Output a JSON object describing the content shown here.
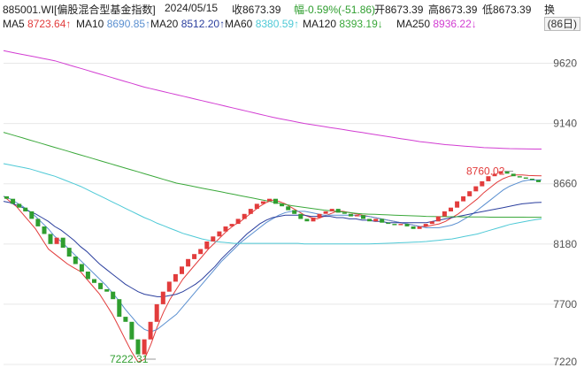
{
  "header": {
    "code_name": "885001.WI[偏股混合型基金指数]",
    "date": "2024/05/15",
    "close": "收8673.39",
    "change": "幅-0.59%(-51.86)",
    "open": "开8673.39",
    "high": "高8673.39",
    "low": "低8673.39",
    "turnover": "换"
  },
  "period_button": "(86日)",
  "ma_labels": [
    {
      "name": "MA5",
      "value": "8723.64↑",
      "color": "#e23c3c"
    },
    {
      "name": "MA10",
      "value": "8690.85↑",
      "color": "#5a8fd0"
    },
    {
      "name": "MA20",
      "value": "8512.20↑",
      "color": "#2b3f9e"
    },
    {
      "name": "MA60",
      "value": "8380.59↑",
      "color": "#4ec9d6"
    },
    {
      "name": "MA120",
      "value": "8393.19↓",
      "color": "#3aa83a"
    },
    {
      "name": "MA250",
      "value": "8936.22↓",
      "color": "#d23dd2"
    }
  ],
  "colors": {
    "up": "#e23c3c",
    "down": "#2f9e2f",
    "grid": "#e8e8e8"
  },
  "chart_data": {
    "type": "line",
    "ylim": [
      7220,
      9800
    ],
    "yticks": [
      7220,
      7700,
      8180,
      8660,
      9140,
      9620
    ],
    "annotations": [
      {
        "text": "8760.02",
        "value": 8760.02,
        "position": "top-right"
      },
      {
        "text": "7222.31",
        "value": 7222.31,
        "position": "bottom-left"
      }
    ],
    "candles": [
      [
        8560,
        8540
      ],
      [
        8540,
        8500
      ],
      [
        8500,
        8470
      ],
      [
        8470,
        8440
      ],
      [
        8440,
        8380
      ],
      [
        8380,
        8320
      ],
      [
        8320,
        8260
      ],
      [
        8260,
        8180
      ],
      [
        8180,
        8230
      ],
      [
        8230,
        8150
      ],
      [
        8150,
        8080
      ],
      [
        8080,
        8020
      ],
      [
        8020,
        7960
      ],
      [
        7960,
        7900
      ],
      [
        7900,
        7870
      ],
      [
        7870,
        7820
      ],
      [
        7820,
        7800
      ],
      [
        7800,
        7740
      ],
      [
        7740,
        7600
      ],
      [
        7600,
        7560
      ],
      [
        7560,
        7420
      ],
      [
        7420,
        7300
      ],
      [
        7300,
        7420
      ],
      [
        7420,
        7560
      ],
      [
        7560,
        7700
      ],
      [
        7700,
        7800
      ],
      [
        7800,
        7880
      ],
      [
        7880,
        7940
      ],
      [
        7940,
        8000
      ],
      [
        8000,
        8060
      ],
      [
        8060,
        8100
      ],
      [
        8100,
        8140
      ],
      [
        8140,
        8200
      ],
      [
        8200,
        8240
      ],
      [
        8240,
        8280
      ],
      [
        8280,
        8320
      ],
      [
        8320,
        8340
      ],
      [
        8340,
        8380
      ],
      [
        8380,
        8420
      ],
      [
        8420,
        8460
      ],
      [
        8460,
        8500
      ],
      [
        8500,
        8520
      ],
      [
        8520,
        8540
      ],
      [
        8540,
        8500
      ],
      [
        8500,
        8480
      ],
      [
        8480,
        8450
      ],
      [
        8450,
        8420
      ],
      [
        8420,
        8380
      ],
      [
        8380,
        8360
      ],
      [
        8360,
        8390
      ],
      [
        8390,
        8420
      ],
      [
        8420,
        8440
      ],
      [
        8440,
        8460
      ],
      [
        8460,
        8430
      ],
      [
        8430,
        8420
      ],
      [
        8420,
        8400
      ],
      [
        8400,
        8410
      ],
      [
        8410,
        8380
      ],
      [
        8380,
        8360
      ],
      [
        8360,
        8380
      ],
      [
        8380,
        8350
      ],
      [
        8350,
        8340
      ],
      [
        8340,
        8330
      ],
      [
        8330,
        8340
      ],
      [
        8340,
        8320
      ],
      [
        8320,
        8300
      ],
      [
        8300,
        8320
      ],
      [
        8320,
        8340
      ],
      [
        8340,
        8360
      ],
      [
        8360,
        8400
      ],
      [
        8400,
        8440
      ],
      [
        8440,
        8470
      ],
      [
        8470,
        8520
      ],
      [
        8520,
        8560
      ],
      [
        8560,
        8600
      ],
      [
        8600,
        8640
      ],
      [
        8640,
        8680
      ],
      [
        8680,
        8720
      ],
      [
        8720,
        8740
      ],
      [
        8740,
        8760
      ],
      [
        8760,
        8740
      ],
      [
        8740,
        8720
      ],
      [
        8720,
        8710
      ],
      [
        8710,
        8700
      ],
      [
        8700,
        8690
      ],
      [
        8690,
        8673
      ]
    ],
    "series": [
      {
        "name": "MA5",
        "color": "#e23c3c",
        "values": [
          8560,
          8520,
          8480,
          8420,
          8360,
          8300,
          8220,
          8140,
          8100,
          8060,
          8020,
          7990,
          7960,
          7900,
          7840,
          7780,
          7700,
          7620,
          7520,
          7420,
          7320,
          7240,
          7260,
          7380,
          7520,
          7640,
          7740,
          7820,
          7900,
          7960,
          8020,
          8080,
          8140,
          8190,
          8240,
          8290,
          8330,
          8360,
          8400,
          8440,
          8480,
          8510,
          8530,
          8520,
          8500,
          8470,
          8440,
          8410,
          8390,
          8380,
          8400,
          8420,
          8440,
          8440,
          8430,
          8420,
          8410,
          8400,
          8390,
          8380,
          8370,
          8360,
          8350,
          8340,
          8330,
          8320,
          8320,
          8330,
          8340,
          8360,
          8390,
          8420,
          8460,
          8500,
          8540,
          8590,
          8630,
          8670,
          8700,
          8720,
          8730,
          8730,
          8726,
          8724,
          8723.64
        ]
      },
      {
        "name": "MA10",
        "color": "#5a8fd0",
        "values": [
          8560,
          8540,
          8510,
          8480,
          8440,
          8400,
          8350,
          8300,
          8240,
          8200,
          8150,
          8100,
          8050,
          8000,
          7950,
          7900,
          7850,
          7790,
          7730,
          7660,
          7600,
          7540,
          7500,
          7480,
          7500,
          7540,
          7580,
          7620,
          7680,
          7740,
          7800,
          7860,
          7920,
          7980,
          8040,
          8090,
          8140,
          8190,
          8230,
          8270,
          8310,
          8350,
          8380,
          8410,
          8430,
          8440,
          8440,
          8440,
          8430,
          8420,
          8410,
          8410,
          8410,
          8410,
          8410,
          8410,
          8400,
          8400,
          8390,
          8380,
          8370,
          8360,
          8350,
          8340,
          8330,
          8320,
          8310,
          8310,
          8310,
          8320,
          8330,
          8350,
          8380,
          8410,
          8450,
          8490,
          8530,
          8570,
          8610,
          8640,
          8660,
          8680,
          8690,
          8690,
          8690.85
        ]
      },
      {
        "name": "MA20",
        "color": "#2b3f9e",
        "values": [
          8520,
          8510,
          8490,
          8470,
          8440,
          8420,
          8390,
          8360,
          8320,
          8290,
          8250,
          8210,
          8160,
          8120,
          8070,
          8020,
          7980,
          7940,
          7900,
          7860,
          7830,
          7800,
          7780,
          7770,
          7760,
          7760,
          7770,
          7780,
          7800,
          7830,
          7860,
          7900,
          7950,
          8000,
          8060,
          8110,
          8160,
          8210,
          8260,
          8300,
          8340,
          8370,
          8390,
          8400,
          8410,
          8410,
          8410,
          8410,
          8400,
          8400,
          8400,
          8400,
          8390,
          8390,
          8380,
          8380,
          8370,
          8370,
          8360,
          8360,
          8350,
          8350,
          8350,
          8350,
          8350,
          8350,
          8350,
          8360,
          8370,
          8380,
          8390,
          8400,
          8410,
          8420,
          8430,
          8440,
          8450,
          8460,
          8470,
          8480,
          8490,
          8500,
          8505,
          8510,
          8512.2
        ]
      },
      {
        "name": "MA60",
        "color": "#4ec9d6",
        "values": [
          8820,
          8810,
          8800,
          8790,
          8780,
          8765,
          8750,
          8735,
          8720,
          8700,
          8680,
          8660,
          8640,
          8615,
          8590,
          8565,
          8540,
          8515,
          8490,
          8465,
          8440,
          8415,
          8390,
          8370,
          8345,
          8325,
          8305,
          8285,
          8265,
          8250,
          8235,
          8220,
          8210,
          8200,
          8195,
          8190,
          8185,
          8185,
          8185,
          8185,
          8185,
          8185,
          8185,
          8185,
          8185,
          8185,
          8185,
          8180,
          8180,
          8180,
          8180,
          8180,
          8180,
          8180,
          8180,
          8180,
          8180,
          8180,
          8182,
          8184,
          8186,
          8188,
          8190,
          8192,
          8194,
          8196,
          8200,
          8205,
          8210,
          8215,
          8220,
          8230,
          8240,
          8250,
          8260,
          8275,
          8290,
          8305,
          8320,
          8335,
          8345,
          8355,
          8365,
          8373,
          8380.59
        ]
      },
      {
        "name": "MA120",
        "color": "#3aa83a",
        "values": [
          9070,
          9055,
          9040,
          9025,
          9010,
          8995,
          8980,
          8965,
          8950,
          8935,
          8920,
          8905,
          8890,
          8875,
          8860,
          8845,
          8830,
          8815,
          8800,
          8785,
          8770,
          8755,
          8740,
          8725,
          8710,
          8695,
          8680,
          8665,
          8655,
          8645,
          8635,
          8625,
          8615,
          8605,
          8595,
          8585,
          8575,
          8565,
          8555,
          8545,
          8535,
          8525,
          8515,
          8505,
          8495,
          8485,
          8478,
          8471,
          8464,
          8457,
          8450,
          8445,
          8440,
          8435,
          8430,
          8425,
          8420,
          8418,
          8416,
          8414,
          8412,
          8410,
          8408,
          8406,
          8404,
          8402,
          8400,
          8399,
          8398,
          8398,
          8397,
          8397,
          8396,
          8396,
          8395,
          8395,
          8394,
          8394,
          8394,
          8394,
          8393.5,
          8393.5,
          8393.3,
          8393.2,
          8393.19
        ]
      },
      {
        "name": "MA250",
        "color": "#d23dd2",
        "values": [
          9720,
          9710,
          9700,
          9690,
          9680,
          9670,
          9660,
          9650,
          9640,
          9625,
          9610,
          9595,
          9580,
          9565,
          9550,
          9535,
          9520,
          9505,
          9490,
          9475,
          9460,
          9445,
          9430,
          9418,
          9406,
          9394,
          9382,
          9370,
          9358,
          9346,
          9334,
          9322,
          9310,
          9298,
          9286,
          9274,
          9262,
          9250,
          9238,
          9226,
          9214,
          9202,
          9190,
          9180,
          9170,
          9160,
          9150,
          9140,
          9132,
          9124,
          9116,
          9108,
          9100,
          9092,
          9084,
          9076,
          9068,
          9060,
          9052,
          9044,
          9036,
          9028,
          9020,
          9012,
          9004,
          8996,
          8990,
          8984,
          8978,
          8972,
          8968,
          8964,
          8960,
          8956,
          8952,
          8948,
          8946,
          8944,
          8942,
          8940,
          8939,
          8938,
          8937,
          8936.5,
          8936.22
        ]
      }
    ]
  }
}
